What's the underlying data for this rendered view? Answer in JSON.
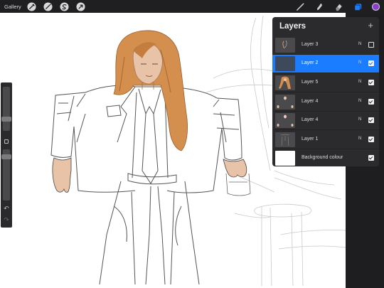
{
  "topbar": {
    "gallery_label": "Gallery",
    "left_tools": [
      "wrench-icon",
      "magic-wand-icon",
      "selection-icon",
      "transform-icon"
    ],
    "right_tools": [
      "brush-icon",
      "smudge-icon",
      "eraser-icon",
      "layers-icon"
    ],
    "color_swatch": "#8b3fd1"
  },
  "sidebar": {
    "brush_size_level": 0.55,
    "opacity_level": 0.3,
    "modify_button": "square",
    "undo_icon": "↶",
    "redo_icon": "↷"
  },
  "layers": {
    "title": "Layers",
    "add_label": "+",
    "rows": [
      {
        "name": "Layer 3",
        "blend": "N",
        "visible": false,
        "active": false,
        "thumb": "sketch"
      },
      {
        "name": "Layer 2",
        "blend": "N",
        "visible": true,
        "active": true,
        "thumb": "empty"
      },
      {
        "name": "Layer 5",
        "blend": "N",
        "visible": true,
        "active": false,
        "thumb": "hair"
      },
      {
        "name": "Layer 4",
        "blend": "N",
        "visible": true,
        "active": false,
        "thumb": "hands"
      },
      {
        "name": "Layer 4",
        "blend": "N",
        "visible": true,
        "active": false,
        "thumb": "hands"
      },
      {
        "name": "Layer 1",
        "blend": "N",
        "visible": true,
        "active": false,
        "thumb": "lines"
      },
      {
        "name": "Background colour",
        "blend": "",
        "visible": true,
        "active": false,
        "thumb": "white"
      }
    ]
  },
  "colors": {
    "topbar": "#1f1f21",
    "panel": "#2b2b2e",
    "active_row": "#1a7cff",
    "hair": "#d48f4e",
    "skin": "#e9c3a8"
  }
}
